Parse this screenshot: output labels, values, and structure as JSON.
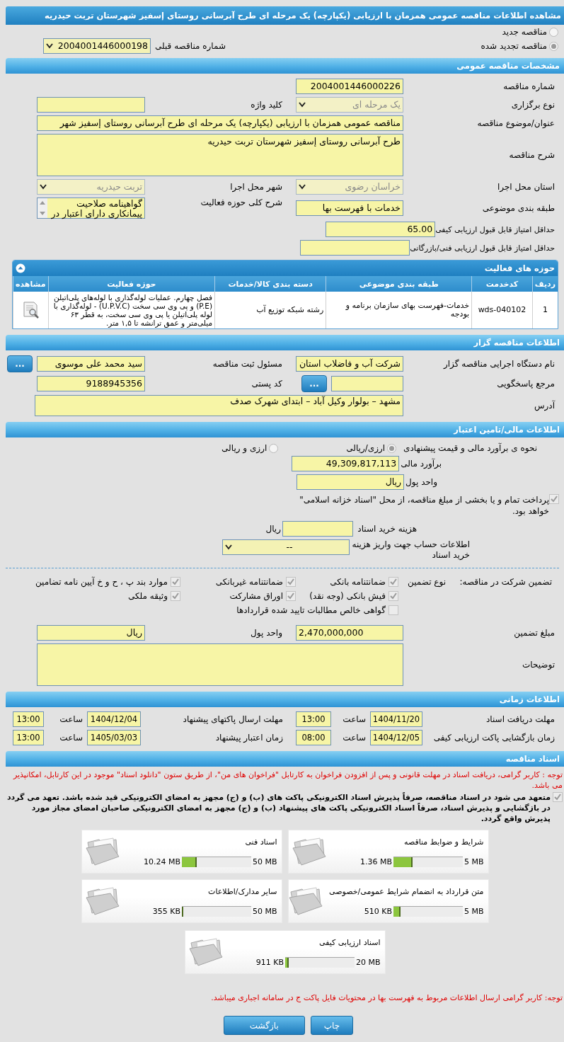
{
  "title": "مشاهده اطلاعات مناقصه عمومی همزمان با ارزیابی (یکپارچه) یک مرحله ای طرح آبرسانی روستای إسفیز شهرستان تربت حیدریه",
  "tender_kind": [
    {
      "label": "مناقصه جدید",
      "selected": false
    },
    {
      "label": "مناقصه تجدید شده",
      "selected": true
    }
  ],
  "previous_tender": {
    "label": "شماره مناقصه قبلی",
    "value": "2004001446000198",
    "kind": "select",
    "disabled": false
  },
  "general": {
    "header": "مشخصات مناقصه عمومی",
    "rows": [
      [
        {
          "label": "شماره مناقصه",
          "value": "2004001446000226",
          "kind": "text"
        }
      ],
      [
        {
          "label": "نوع برگزاری",
          "value": "یک مرحله ای",
          "kind": "select",
          "disabled": true
        },
        {
          "label": "کلید واژه",
          "kind": "text"
        }
      ],
      [
        {
          "label": "عنوان/موضوع مناقصه",
          "value": "مناقصه عمومی همزمان با ارزیابی (یکپارچه) یک مرحله ای طرح آبرسانی روستای إسفیز  شهر",
          "kind": "wide"
        }
      ],
      [
        {
          "label": "شرح مناقصه",
          "value": "طرح آبرسانی روستای إسفیز  شهرستان تربت حیدریه",
          "kind": "textarea"
        }
      ],
      [
        {
          "label": "استان محل اجرا",
          "value": "خراسان رضوی",
          "kind": "select",
          "disabled": true
        },
        {
          "label": "شهر محل اجرا",
          "value": "تربت حیدریه",
          "kind": "select",
          "disabled": true
        }
      ],
      [
        {
          "label": "طبقه بندی موضوعی",
          "value": "خدمات با فهرست بها",
          "kind": "text"
        },
        {
          "label": "شرح کلی حوزه فعالیت",
          "lines": [
            "گواهینامه صلاحیت",
            "پیمانکاری  دارای اعتبار در"
          ],
          "kind": "listbox"
        }
      ],
      [
        {
          "label": "حداقل امتیاز قابل قبول ارزیابی کیفی",
          "value": "65.00",
          "kind": "score"
        }
      ],
      [
        {
          "label": "حداقل امتیاز قابل قبول ارزیابی فنی/بازرگانی",
          "kind": "score"
        }
      ]
    ]
  },
  "activities": {
    "header": "حوزه های فعالیت",
    "expanded": true,
    "columns": [
      "ردیف",
      "کدخدمت",
      "طبقه بندی موضوعی",
      "دسته بندی کالا/خدمات",
      "حوزه فعالیت",
      "مشاهده"
    ],
    "rows": [
      {
        "cells": [
          "1",
          "wds-040102",
          "خدمات-فهرست بهای سازمان برنامه و بودجه",
          "رشته شبکه توزیع آب",
          "فصل چهارم. عملیات لوله‌گذاری با لوله‌های پلی‌اتیلن (P.E) و پی وی سی سخت (U.P.V.C) - لوله‌گذاری با لوله پلی‌اتیلن یا پی وی سی سخت، به قطر ۶۳ میلی‌متر و عمق ترانشه تا ۱,۵ متر."
        ]
      }
    ]
  },
  "tenderer": {
    "header": "اطلاعات مناقصه گزار",
    "rows": [
      [
        {
          "label": "نام دستگاه اجرایی مناقصه گزار",
          "value": "شرکت آب و فاضلاب استان",
          "kind": "text"
        },
        {
          "label": "مسئول ثبت مناقصه",
          "value": "سید محمد علی موسوی",
          "kind": "text",
          "button": "..."
        }
      ],
      [
        {
          "label": "مرجع پاسخگویی",
          "kind": "lookup",
          "button": "..."
        },
        {
          "label": "کد پستی",
          "value": "9188945356",
          "kind": "text"
        }
      ],
      [
        {
          "label": "آدرس",
          "value": "مشهد – بولوار وکیل آباد – ابتدای شهرک صدف",
          "kind": "address"
        }
      ]
    ]
  },
  "finance": {
    "header": "اطلاعات مالی/تامین اعتبار",
    "estimate_method": {
      "label": "نحوه ی برآورد مالی و قیمت پیشنهادی",
      "options": [
        {
          "label": "ارزی/ریالی",
          "selected": true
        },
        {
          "label": "ارزی و ریالی",
          "selected": false
        }
      ]
    },
    "estimate": {
      "label": "برآورد مالی",
      "value": "49,309,817,113"
    },
    "currency": {
      "label": "واحد پول",
      "value": "ریال"
    },
    "treasury": {
      "checked": true,
      "text": "پرداخت تمام و یا بخشی از مبلغ مناقصه، از محل \"اسناد خزانه اسلامی\" خواهد بود."
    },
    "document_fee": {
      "label": "هزینه خرید اسناد",
      "unit": "ریال"
    },
    "fee_account": {
      "label": "اطلاعات حساب جهت واریز هزینه خرید اسناد",
      "value": "--"
    }
  },
  "guarantee": {
    "label": "تضمین شرکت در مناقصه:",
    "type_label": "نوع تضمین",
    "options": [
      {
        "label": "ضمانتنامه بانکی",
        "checked": true
      },
      {
        "label": "ضمانتنامه غیربانکی",
        "checked": true
      },
      {
        "label": "موارد بند پ ، ح و خ آیین نامه تضامین",
        "checked": true
      },
      {
        "label": "فیش بانکی (وجه نقد)",
        "checked": true
      },
      {
        "label": "اوراق مشارکت",
        "checked": true
      },
      {
        "label": "وثیقه ملکی",
        "checked": true
      },
      {
        "label": "گواهی خالص مطالبات تایید شده قراردادها",
        "checked": false
      }
    ],
    "amount": {
      "label": "مبلغ تضمین",
      "value": "2,470,000,000"
    },
    "currency": {
      "label": "واحد پول",
      "value": "ریال"
    },
    "notes": {
      "label": "توضیحات"
    }
  },
  "schedule": {
    "header": "اطلاعات زمانی",
    "rows": [
      [
        {
          "label": "مهلت دریافت اسناد",
          "date": "1404/11/20",
          "time_label": "ساعت",
          "time": "13:00"
        },
        {
          "label": "مهلت ارسال پاکتهای پیشنهاد",
          "date": "1404/12/04",
          "time_label": "ساعت",
          "time": "13:00"
        }
      ],
      [
        {
          "label": "زمان بازگشایی پاکت ارزیابی کیفی",
          "date": "1404/12/05",
          "time_label": "ساعت",
          "time": "08:00"
        },
        {
          "label": "زمان اعتبار پیشنهاد",
          "date": "1405/03/03",
          "time_label": "ساعت",
          "time": "13:00"
        }
      ]
    ]
  },
  "documents": {
    "header": "اسناد مناقصه",
    "notice": "توجه : کاربر گرامی، دریافت اسناد در مهلت قانونی و پس از افزودن فراخوان به کارتابل \"فراخوان های من\"، از طریق ستون \"دانلود اسناد\" موجود در این کارتابل، امکانپذیر می باشد.",
    "commitment": {
      "checked": true,
      "text": "متعهد می شود در اسناد مناقصه، صرفاً پذیرش اسناد الکترونیکی پاکت های (ب) و (ج) مجهز به امضای الکترونیکی قید شده باشد. تعهد می گردد در بازگشایی و پذیرش اسناد، صرفاً اسناد الکترونیکی پاکت های پیشنهاد (ب) و (ج) مجهز به امضای الکترونیکی صاحبان امضای مجاز مورد پذیرش واقع گردد."
    },
    "files": [
      {
        "name": "شرایط و ضوابط مناقصه",
        "used": "1.36 MB",
        "max": "5 MB",
        "level": 0.28
      },
      {
        "name": "اسناد فنی",
        "used": "10.24 MB",
        "max": "50 MB",
        "level": 0.21
      },
      {
        "name": "متن قرارداد به انضمام شرایط عمومی/خصوصی",
        "used": "510 KB",
        "max": "5 MB",
        "level": 0.1
      },
      {
        "name": "سایر مدارک/اطلاعات",
        "used": "355 KB",
        "max": "50 MB",
        "level": 0.01
      },
      {
        "name": "اسناد ارزیابی کیفی",
        "used": "911 KB",
        "max": "20 MB",
        "level": 0.05
      }
    ]
  },
  "footer_notice": "توجه: کاربر گرامی ارسال اطلاعات مربوط به فهرست بها در محتویات فایل پاکت ج در سامانه اجباری میباشد.",
  "buttons": [
    "چاپ",
    "بازگشت"
  ]
}
